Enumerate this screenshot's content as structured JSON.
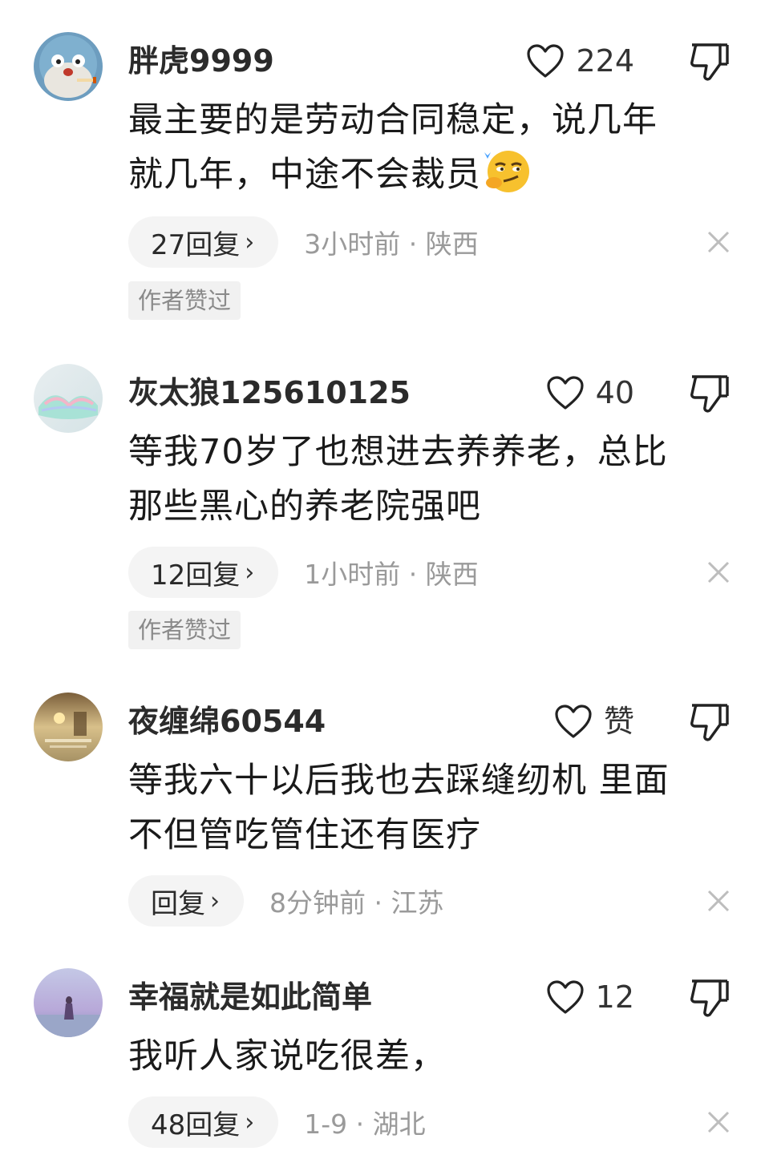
{
  "comments": [
    {
      "username": "胖虎9999",
      "like_count": "224",
      "text_line1": "最主要的是劳动合同稳定，说几年",
      "text_line2": "就几年，中途不会裁员",
      "emoji": "smirk-emoji",
      "reply_label": "27回复",
      "meta": "3小时前 · 陕西",
      "author_tag": "作者赞过"
    },
    {
      "username": "灰太狼125610125",
      "like_count": "40",
      "text_line1": "等我70岁了也想进去养养老，总比",
      "text_line2": "那些黑心的养老院强吧",
      "reply_label": "12回复",
      "meta": "1小时前 · 陕西",
      "author_tag": "作者赞过"
    },
    {
      "username": "夜缠绵60544",
      "like_count": "赞",
      "text_line1": "等我六十以后我也去踩缝纫机 里面",
      "text_line2": "不但管吃管住还有医疗",
      "reply_label": "回复",
      "meta": "8分钟前 · 江苏"
    },
    {
      "username": "幸福就是如此简单",
      "like_count": "12",
      "text_line1": "我听人家说吃很差，",
      "reply_label": "48回复",
      "meta": "1-9 · 湖北"
    }
  ],
  "icons": {
    "like": "heart-outline-icon",
    "dislike": "thumbs-down-icon",
    "close": "close-icon",
    "chevron": "chevron-right-icon"
  },
  "chevron_glyph": "›"
}
